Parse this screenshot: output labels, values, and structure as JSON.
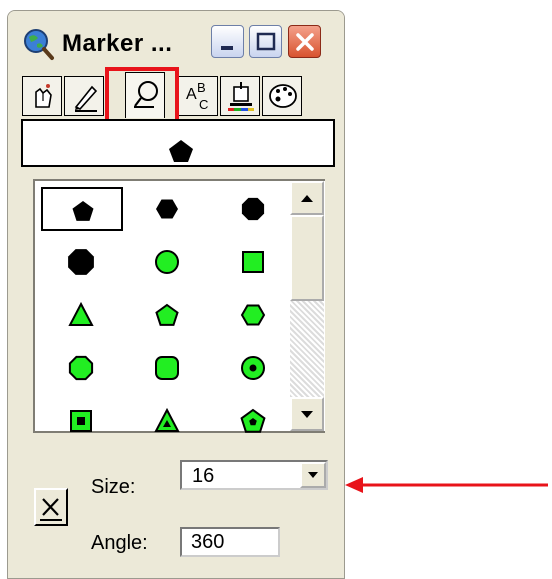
{
  "window": {
    "title": "Marker ...",
    "icon": "globe-magnifier-icon"
  },
  "titlebar_buttons": [
    "minimize-icon",
    "maximize-icon",
    "close-icon"
  ],
  "tabs": [
    {
      "icon": "pointer-edit-icon",
      "active": false
    },
    {
      "icon": "pencil-icon",
      "active": false
    },
    {
      "icon": "marker-icon",
      "active": true
    },
    {
      "icon": "text-abc-icon",
      "active": false
    },
    {
      "icon": "fill-bucket-icon",
      "active": false
    },
    {
      "icon": "palette-icon",
      "active": false
    }
  ],
  "preview": {
    "shape": "pentagon",
    "color": "#000000"
  },
  "markers": [
    {
      "shape": "pentagon",
      "fill": "#000000",
      "selected": true
    },
    {
      "shape": "hexagon",
      "fill": "#000000"
    },
    {
      "shape": "octagon",
      "fill": "#000000"
    },
    {
      "shape": "octagon-large",
      "fill": "#000000"
    },
    {
      "shape": "circle",
      "fill": "#22ee22"
    },
    {
      "shape": "square",
      "fill": "#22ee22"
    },
    {
      "shape": "triangle",
      "fill": "#22ee22"
    },
    {
      "shape": "pentagon",
      "fill": "#22ee22"
    },
    {
      "shape": "hexagon",
      "fill": "#22ee22"
    },
    {
      "shape": "octagon",
      "fill": "#22ee22"
    },
    {
      "shape": "rounded-square",
      "fill": "#22ee22"
    },
    {
      "shape": "circle-dot",
      "fill": "#22ee22"
    },
    {
      "shape": "square-dot",
      "fill": "#22ee22"
    },
    {
      "shape": "triangle-dot",
      "fill": "#22ee22"
    },
    {
      "shape": "pentagon-dot",
      "fill": "#22ee22"
    }
  ],
  "controls": {
    "size_label": "Size:",
    "size_value": "16",
    "angle_label": "Angle:",
    "angle_value": "360",
    "reset_icon": "x-reset-icon"
  },
  "colors": {
    "marker_green": "#22ee22",
    "highlight_red": "#e8131a",
    "window_bg": "#ece9d8"
  }
}
